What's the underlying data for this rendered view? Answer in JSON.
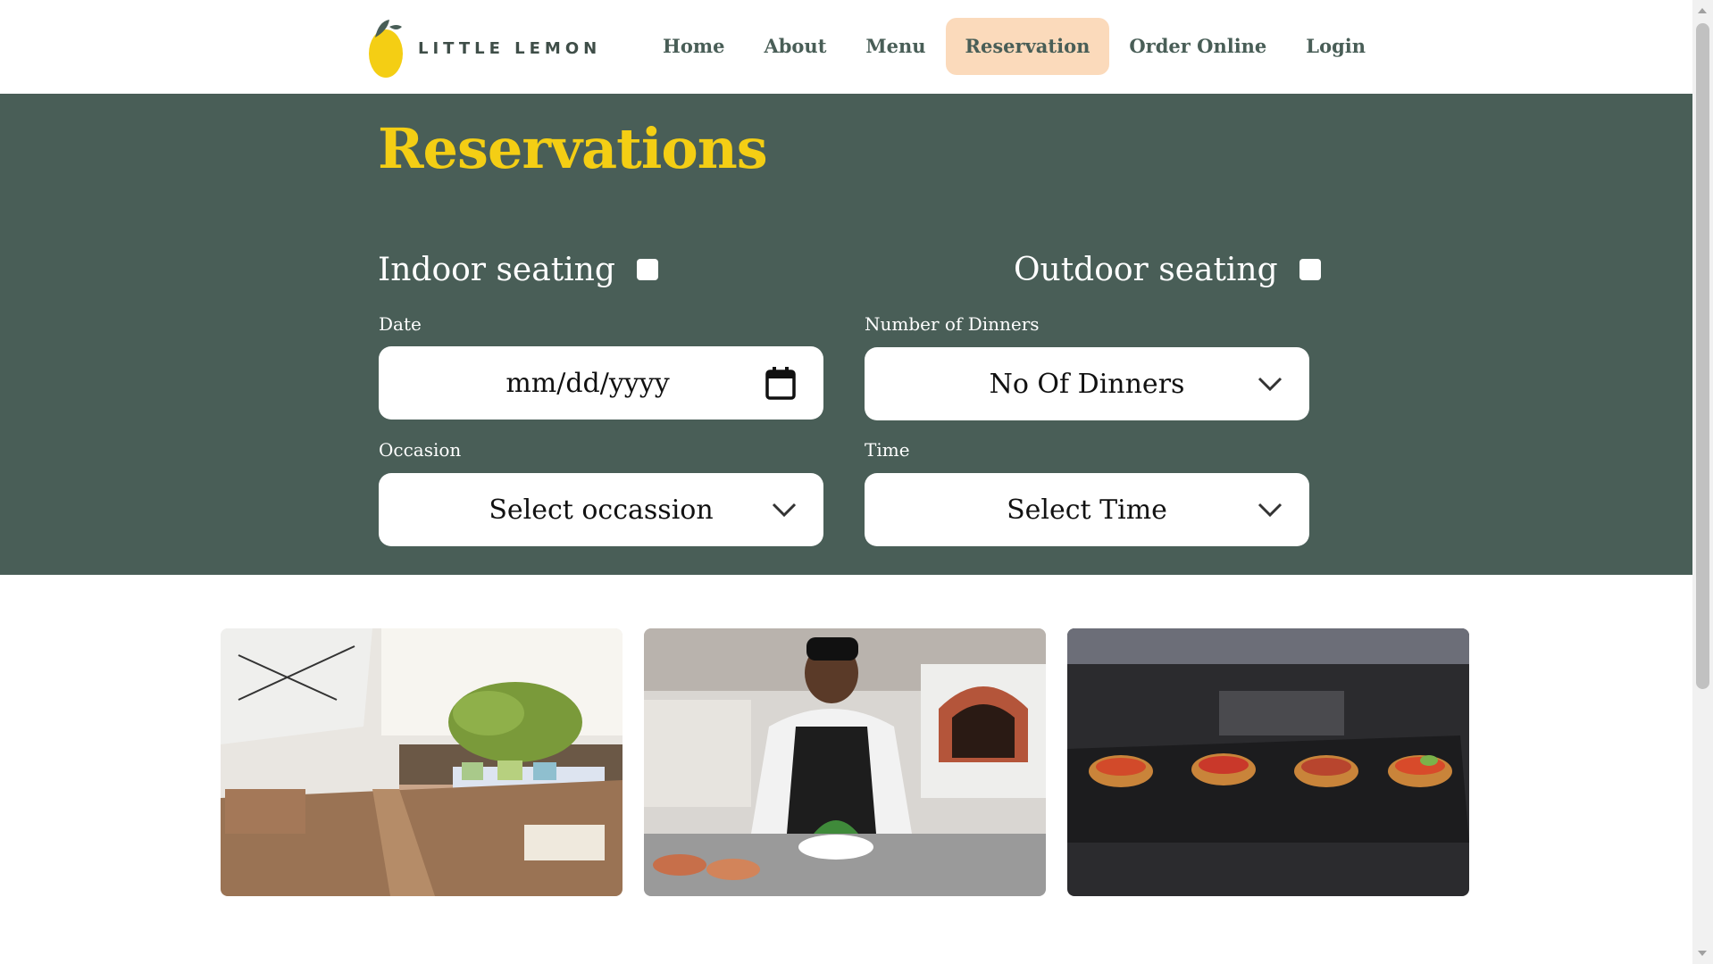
{
  "header": {
    "brand": "LITTLE LEMON",
    "nav": [
      {
        "label": "Home"
      },
      {
        "label": "About"
      },
      {
        "label": "Menu"
      },
      {
        "label": "Reservation",
        "active": true
      },
      {
        "label": "Order Online"
      },
      {
        "label": "Login"
      }
    ]
  },
  "form": {
    "title": "Reservations",
    "indoor_label": "Indoor seating",
    "outdoor_label": "Outdoor seating",
    "indoor_checked": false,
    "outdoor_checked": false,
    "date": {
      "label": "Date",
      "placeholder": "mm/dd/yyyy"
    },
    "dinners": {
      "label": "Number of Dinners",
      "value": "No Of Dinners"
    },
    "occasion": {
      "label": "Occasion",
      "value": "Select occassion"
    },
    "time": {
      "label": "Time",
      "value": "Select Time"
    }
  },
  "gallery": [
    {
      "name": "restaurant-terrace-image"
    },
    {
      "name": "chef-plating-image"
    },
    {
      "name": "bruschetta-platter-image"
    }
  ],
  "colors": {
    "primary_green": "#495e57",
    "primary_yellow": "#f4ce14",
    "active_nav_bg": "#fbdabb",
    "white": "#ffffff"
  },
  "icons": {
    "logo": "lemon-logo-icon",
    "calendar": "calendar-icon",
    "dropdown": "chevron-down-icon"
  }
}
